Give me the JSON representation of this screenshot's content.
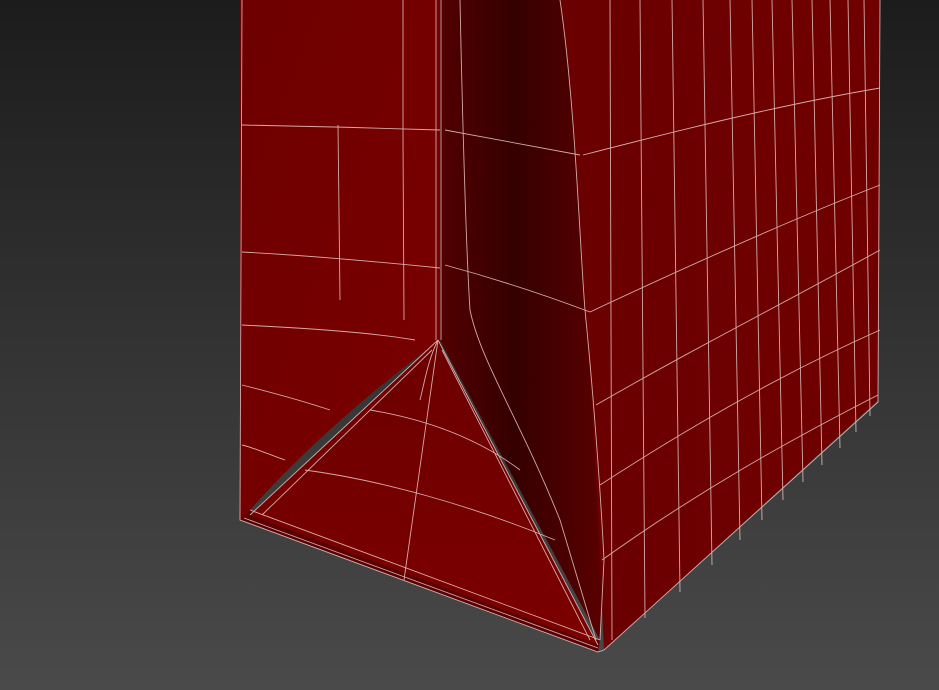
{
  "viewport": {
    "background_top": "#1c1c1c",
    "background_bottom": "#4a4a4a"
  },
  "model": {
    "shape": "quad-mesh shopping bag with folded gusset corner",
    "color_light": "#7a0000",
    "color_base": "#6a0000",
    "color_dark": "#3a0000",
    "wireframe_color": "#e8c8c8"
  }
}
